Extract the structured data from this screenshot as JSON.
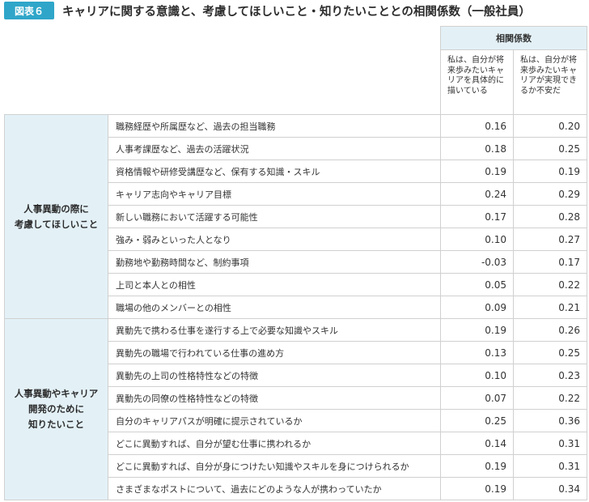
{
  "figure_label": "図表６",
  "title": "キャリアに関する意識と、考慮してほしいこと・知りたいこととの相関係数（一般社員）",
  "header": {
    "coef_label": "相関係数",
    "col1": "私は、自分が将来歩みたいキャリアを具体的に描いている",
    "col2": "私は、自分が将来歩みたいキャリアが実現できるか不安だ"
  },
  "groups": [
    {
      "label": "人事異動の際に\n考慮してほしいこと",
      "rows": [
        {
          "item": "職務経歴や所属歴など、過去の担当職務",
          "v1": "0.16",
          "v2": "0.20"
        },
        {
          "item": "人事考課歴など、過去の活躍状況",
          "v1": "0.18",
          "v2": "0.25"
        },
        {
          "item": "資格情報や研修受講歴など、保有する知識・スキル",
          "v1": "0.19",
          "v2": "0.19"
        },
        {
          "item": "キャリア志向やキャリア目標",
          "v1": "0.24",
          "v2": "0.29"
        },
        {
          "item": "新しい職務において活躍する可能性",
          "v1": "0.17",
          "v2": "0.28"
        },
        {
          "item": "強み・弱みといった人となり",
          "v1": "0.10",
          "v2": "0.27"
        },
        {
          "item": "勤務地や勤務時間など、制約事項",
          "v1": "-0.03",
          "v2": "0.17"
        },
        {
          "item": "上司と本人との相性",
          "v1": "0.05",
          "v2": "0.22"
        },
        {
          "item": "職場の他のメンバーとの相性",
          "v1": "0.09",
          "v2": "0.21"
        }
      ]
    },
    {
      "label": "人事異動やキャリア\n開発のために\n知りたいこと",
      "rows": [
        {
          "item": "異動先で携わる仕事を遂行する上で必要な知識やスキル",
          "v1": "0.19",
          "v2": "0.26"
        },
        {
          "item": "異動先の職場で行われている仕事の進め方",
          "v1": "0.13",
          "v2": "0.25"
        },
        {
          "item": "異動先の上司の性格特性などの特徴",
          "v1": "0.10",
          "v2": "0.23"
        },
        {
          "item": "異動先の同僚の性格特性などの特徴",
          "v1": "0.07",
          "v2": "0.22"
        },
        {
          "item": "自分のキャリアパスが明確に提示されているか",
          "v1": "0.25",
          "v2": "0.36"
        },
        {
          "item": "どこに異動すれば、自分が望む仕事に携われるか",
          "v1": "0.14",
          "v2": "0.31"
        },
        {
          "item": "どこに異動すれば、自分が身につけたい知識やスキルを身につけられるか",
          "v1": "0.19",
          "v2": "0.31"
        },
        {
          "item": "さまざまなポストについて、過去にどのような人が携わっていたか",
          "v1": "0.19",
          "v2": "0.34"
        }
      ]
    }
  ]
}
